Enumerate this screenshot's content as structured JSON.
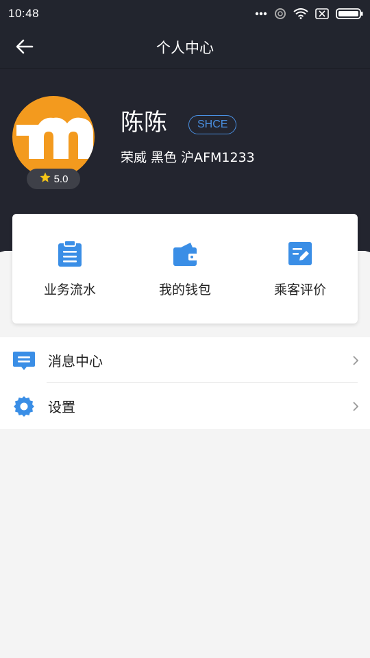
{
  "status_bar": {
    "time": "10:48",
    "icons": [
      "more-dots-icon",
      "alarm-icon",
      "wifi-icon",
      "sim-off-icon",
      "battery-icon"
    ]
  },
  "header": {
    "title": "个人中心",
    "back_icon": "back-arrow-icon"
  },
  "profile": {
    "name": "陈陈",
    "company_badge": "SHCE",
    "vehicle": "荣威 黑色 沪AFM1233",
    "rating": "5.0",
    "avatar_letter": "m"
  },
  "actions": [
    {
      "label": "业务流水",
      "icon": "clipboard-icon"
    },
    {
      "label": "我的钱包",
      "icon": "wallet-icon"
    },
    {
      "label": "乘客评价",
      "icon": "edit-review-icon"
    }
  ],
  "menu": [
    {
      "label": "消息中心",
      "icon": "message-icon"
    },
    {
      "label": "设置",
      "icon": "settings-gear-icon"
    }
  ],
  "colors": {
    "header_bg": "#22252e",
    "accent_blue": "#3a8ee6",
    "avatar_orange": "#f39a1e",
    "page_bg": "#f4f4f4"
  }
}
